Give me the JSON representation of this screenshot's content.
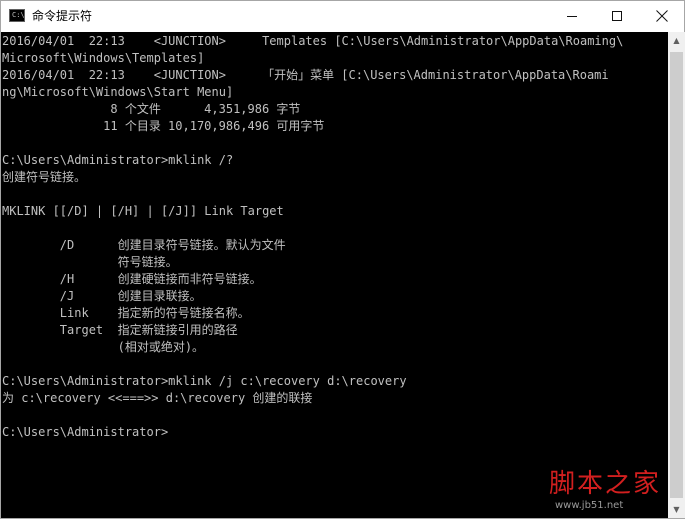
{
  "window": {
    "title": "命令提示符",
    "icon": "console-icon",
    "icon_text": "C:\\"
  },
  "controls": {
    "minimize": "minimize-icon",
    "maximize": "maximize-icon",
    "close": "close-icon"
  },
  "console": {
    "lines": [
      "2016/04/01  22:13    <JUNCTION>     Templates [C:\\Users\\Administrator\\AppData\\Roaming\\",
      "Microsoft\\Windows\\Templates]",
      "2016/04/01  22:13    <JUNCTION>     「开始」菜单 [C:\\Users\\Administrator\\AppData\\Roami",
      "ng\\Microsoft\\Windows\\Start Menu]",
      "               8 个文件      4,351,986 字节",
      "              11 个目录 10,170,986,496 可用字节",
      "",
      "C:\\Users\\Administrator>mklink /?",
      "创建符号链接。",
      "",
      "MKLINK [[/D] | [/H] | [/J]] Link Target",
      "",
      "        /D      创建目录符号链接。默认为文件",
      "                符号链接。",
      "        /H      创建硬链接而非符号链接。",
      "        /J      创建目录联接。",
      "        Link    指定新的符号链接名称。",
      "        Target  指定新链接引用的路径",
      "                (相对或绝对)。",
      "",
      "C:\\Users\\Administrator>mklink /j c:\\recovery d:\\recovery",
      "为 c:\\recovery <<===>> d:\\recovery 创建的联接",
      "",
      "C:\\Users\\Administrator>"
    ]
  },
  "watermark": {
    "logo": "脚本之家",
    "url": "www.jb51.net"
  },
  "colors": {
    "console_background": "#000000",
    "console_text": "#c0c0c0",
    "titlebar_background": "#ffffff",
    "watermark": "#d21f1f"
  }
}
